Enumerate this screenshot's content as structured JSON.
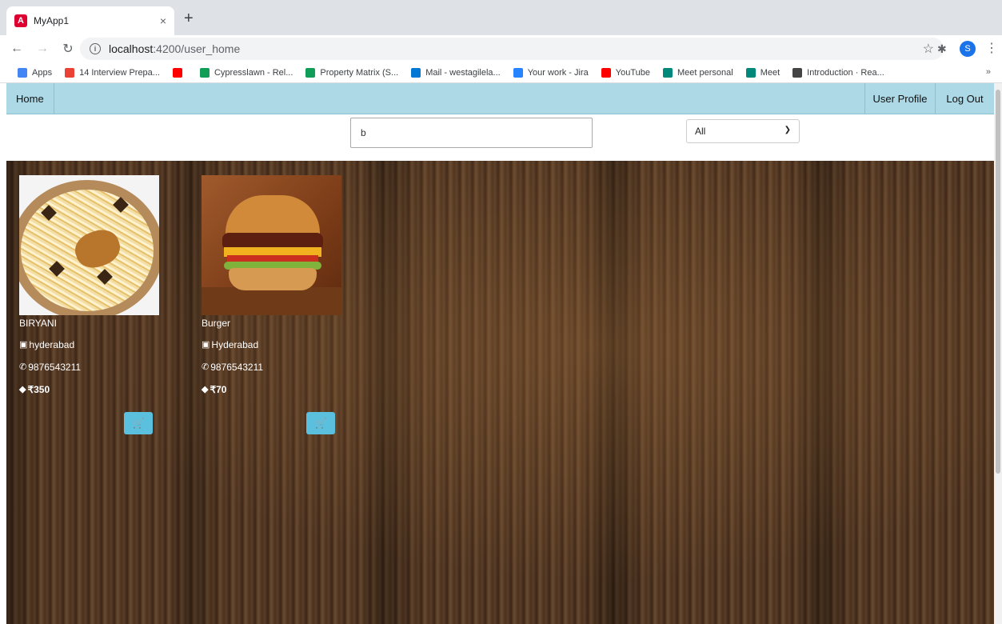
{
  "browser": {
    "tab_title": "MyApp1",
    "tab_close": "×",
    "new_tab": "+",
    "url_host": "localhost",
    "url_rest": ":4200/user_home",
    "profile_initial": "S"
  },
  "bookmarks": [
    {
      "label": "Apps",
      "color": "#4285f4"
    },
    {
      "label": "14 Interview Prepa...",
      "color": "#ea4335"
    },
    {
      "label": "",
      "color": "#ff0000"
    },
    {
      "label": "Cypresslawn - Rel...",
      "color": "#0f9d58"
    },
    {
      "label": "Property Matrix (S...",
      "color": "#0f9d58"
    },
    {
      "label": "Mail - westagilela...",
      "color": "#0078d4"
    },
    {
      "label": "Your work - Jira",
      "color": "#2684ff"
    },
    {
      "label": "YouTube",
      "color": "#ff0000"
    },
    {
      "label": "Meet personal",
      "color": "#00897b"
    },
    {
      "label": "Meet",
      "color": "#00897b"
    },
    {
      "label": "Introduction · Rea...",
      "color": "#444444"
    }
  ],
  "bookmarks_more": "»",
  "nav": {
    "home": "Home",
    "user_profile": "User Profile",
    "log_out": "Log Out"
  },
  "search": {
    "value": "b",
    "filter_selected": "All"
  },
  "items": [
    {
      "name": "BIRYANI",
      "location": "hyderabad",
      "phone": "9876543211",
      "price": "₹350"
    },
    {
      "name": "Burger",
      "location": "Hyderabad",
      "phone": "9876543211",
      "price": "₹70"
    }
  ],
  "colors": {
    "navbar": "#add8e6",
    "cart_button": "#5bc0de"
  }
}
